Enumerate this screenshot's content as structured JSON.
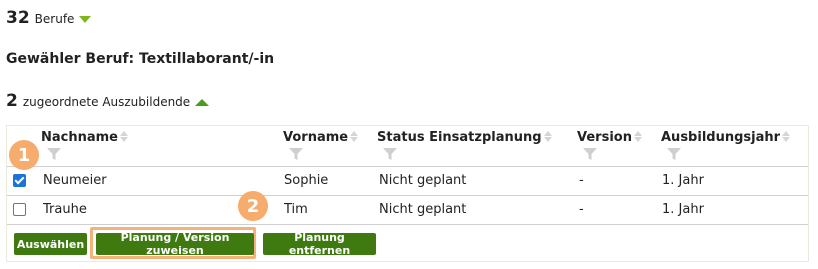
{
  "berufe": {
    "count": "32",
    "label": "Berufe"
  },
  "heading": "Gewähler Beruf: Textillaborant/-in",
  "azubi": {
    "count": "2",
    "label": "zugeordnete Auszubildende"
  },
  "table": {
    "columns": [
      "Nachname",
      "Vorname",
      "Status Einsatzplanung",
      "Version",
      "Ausbildungsjahr"
    ],
    "rows": [
      {
        "checked": true,
        "nachname": "Neumeier",
        "vorname": "Sophie",
        "status": "Nicht geplant",
        "version": "-",
        "jahr": "1. Jahr"
      },
      {
        "checked": false,
        "nachname": "Trauhe",
        "vorname": "Tim",
        "status": "Nicht geplant",
        "version": "-",
        "jahr": "1. Jahr"
      }
    ]
  },
  "buttons": {
    "select": "Auswählen",
    "assign": "Planung / Version zuweisen",
    "remove": "Planung entfernen"
  },
  "badges": {
    "one": "1",
    "two": "2"
  },
  "colors": {
    "button_green": "#3f7a10",
    "triangle_light_green": "#7fb61e",
    "triangle_dark_green": "#4e9a1e",
    "badge_orange": "#f5ac6d",
    "checkbox_blue": "#1a73d9"
  }
}
